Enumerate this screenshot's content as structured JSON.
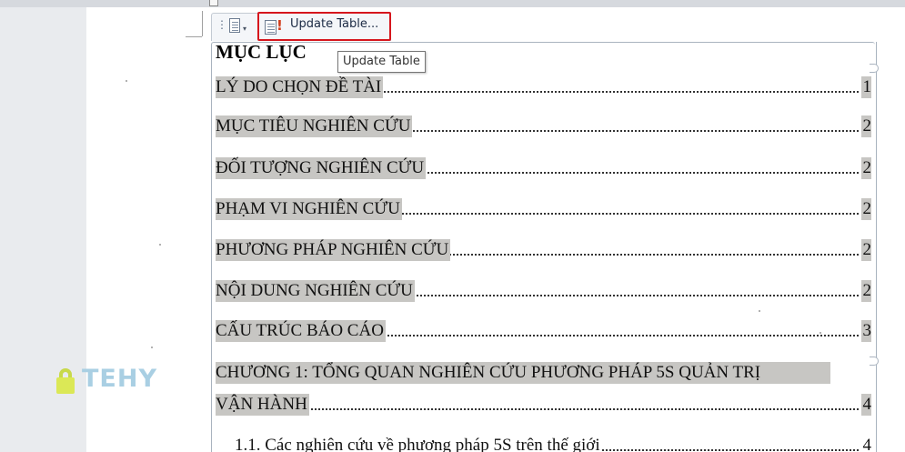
{
  "toolbar": {
    "handle_glyph": "⋮",
    "update_button_label": "Update Table...",
    "tooltip": "Update Table"
  },
  "toc": {
    "title": "MỤC LỤC",
    "entries": [
      {
        "text": "LÝ DO CHỌN ĐỀ TÀI",
        "page": "1"
      },
      {
        "text": "MỤC TIÊU NGHIÊN CỨU",
        "page": "2"
      },
      {
        "text": "ĐỐI TƯỢNG NGHIÊN CỨU",
        "page": "2"
      },
      {
        "text": "PHẠM VI NGHIÊN CỨU",
        "page": "2"
      },
      {
        "text": "PHƯƠNG PHÁP NGHIÊN CỨU",
        "page": "2"
      },
      {
        "text": "NỘI DUNG NGHIÊN CỨU",
        "page": "2"
      },
      {
        "text": "CẤU TRÚC BÁO CÁO",
        "page": "3"
      },
      {
        "text": "CHƯƠNG 1: TỔNG QUAN NGHIÊN CỨU PHƯƠNG PHÁP 5S QUẢN TRỊ"
      },
      {
        "text": "VẬN HÀNH",
        "page": "4"
      },
      {
        "text": "1.1. Các nghiên cứu về phương pháp 5S trên thế giới",
        "page": "4"
      }
    ]
  },
  "watermark": {
    "logo_text": "TEHY"
  },
  "colors": {
    "highlight_box": "#d6161d",
    "field_shading": "#c7c6c3",
    "page": "#ffffff"
  },
  "icons": [
    "drag-handle-icon",
    "document-icon",
    "update-table-icon",
    "lock-icon"
  ]
}
